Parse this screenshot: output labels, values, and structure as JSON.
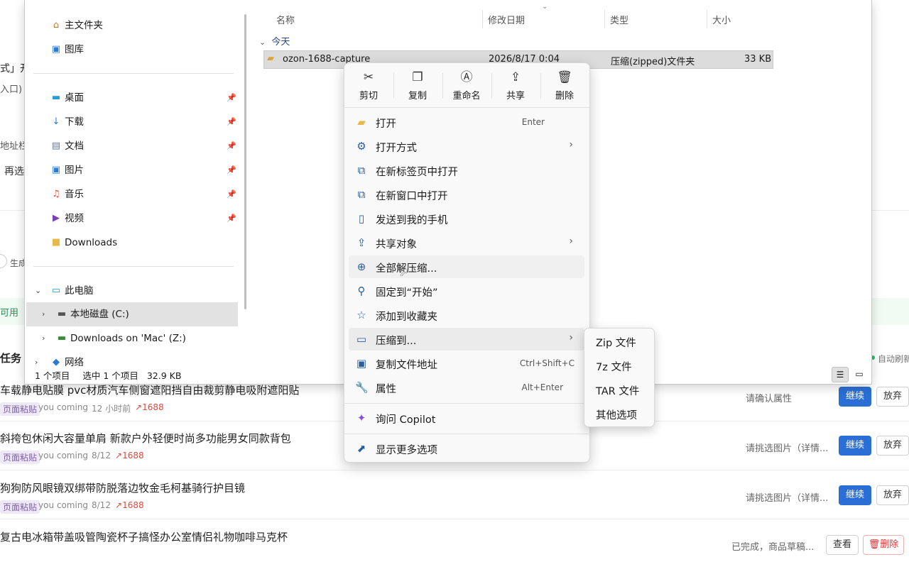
{
  "background_page": {
    "fragments": [
      "式」开",
      "入口)",
      "地址栏",
      "再选",
      "生成",
      "可用",
      "务",
      "自动刷新"
    ],
    "section_title": "任务",
    "tasks": [
      {
        "title": "车载静电贴膜 pvc材质汽车侧窗遮阳挡自由裁剪静电吸附遮阳贴",
        "tag": "页面粘贴",
        "user": "you coming",
        "time": "12 小时前",
        "source": "1688",
        "status": "请确认属性",
        "primary": "继续",
        "secondary": "放弃"
      },
      {
        "title": "斜挎包休闲大容量单肩 新款户外轻便时尚多功能男女同款背包",
        "tag": "页面粘贴",
        "user": "you coming",
        "time": "8/12",
        "source": "1688",
        "status": "请挑选图片（详情...",
        "primary": "继续",
        "secondary": "放弃"
      },
      {
        "title": "狗狗防风眼镜双绑带防脱落边牧金毛柯基骑行护目镜",
        "tag": "页面粘贴",
        "user": "you coming",
        "time": "8/12",
        "source": "1688",
        "status": "请挑选图片（详情...",
        "primary": "继续",
        "secondary": "放弃"
      },
      {
        "title": "复古电冰箱带盖吸管陶瓷杯子搞怪办公室情侣礼物咖啡马克杯",
        "tag": "",
        "user": "",
        "time": "",
        "source": "",
        "status": "已完成，商品草稿...",
        "primary": "查看",
        "secondary": "删除"
      }
    ]
  },
  "explorer": {
    "nav": {
      "home": "主文件夹",
      "gallery": "图库",
      "pinned": [
        {
          "label": "桌面",
          "icon": "desktop-icon"
        },
        {
          "label": "下载",
          "icon": "download-icon"
        },
        {
          "label": "文档",
          "icon": "document-icon"
        },
        {
          "label": "图片",
          "icon": "pictures-icon"
        },
        {
          "label": "音乐",
          "icon": "music-icon"
        },
        {
          "label": "视频",
          "icon": "video-icon"
        }
      ],
      "downloads": "Downloads",
      "this_pc": "此电脑",
      "local_disk": "本地磁盘 (C:)",
      "mac_drive": "Downloads on 'Mac' (Z:)",
      "network": "网络"
    },
    "columns": {
      "name": "名称",
      "modified": "修改日期",
      "type": "类型",
      "size": "大小"
    },
    "group": "今天",
    "file": {
      "name": "ozon-1688-capture",
      "date": "2026/8/17 0:04",
      "type": "压缩(zipped)文件夹",
      "size": "33 KB"
    },
    "status": {
      "count": "1 个项目",
      "selected": "选中 1 个项目",
      "selected_size": "32.9 KB"
    }
  },
  "context_menu": {
    "quick_actions": [
      {
        "label": "剪切",
        "icon": "cut-icon"
      },
      {
        "label": "复制",
        "icon": "copy-icon"
      },
      {
        "label": "重命名",
        "icon": "rename-icon"
      },
      {
        "label": "共享",
        "icon": "share-icon"
      },
      {
        "label": "删除",
        "icon": "trash-icon"
      }
    ],
    "items": [
      {
        "label": "打开",
        "shortcut": "Enter"
      },
      {
        "label": "打开方式",
        "submenu": true
      },
      {
        "label": "在新标签页中打开"
      },
      {
        "label": "在新窗口中打开"
      },
      {
        "label": "发送到我的手机"
      },
      {
        "label": "共享对象",
        "submenu": true
      },
      {
        "label": "全部解压缩..."
      },
      {
        "label": "固定到“开始”"
      },
      {
        "label": "添加到收藏夹"
      },
      {
        "label": "压缩到...",
        "submenu": true
      },
      {
        "label": "复制文件地址",
        "shortcut": "Ctrl+Shift+C"
      },
      {
        "label": "属性",
        "shortcut": "Alt+Enter"
      },
      {
        "label": "询问 Copilot"
      },
      {
        "label": "显示更多选项"
      }
    ],
    "compress_submenu": [
      "Zip 文件",
      "7z 文件",
      "TAR 文件",
      "其他选项"
    ]
  },
  "colors": {
    "accent": "#2b6fd6",
    "selection": "#dcdcdc",
    "menu_bg": "#f9f9f9"
  }
}
